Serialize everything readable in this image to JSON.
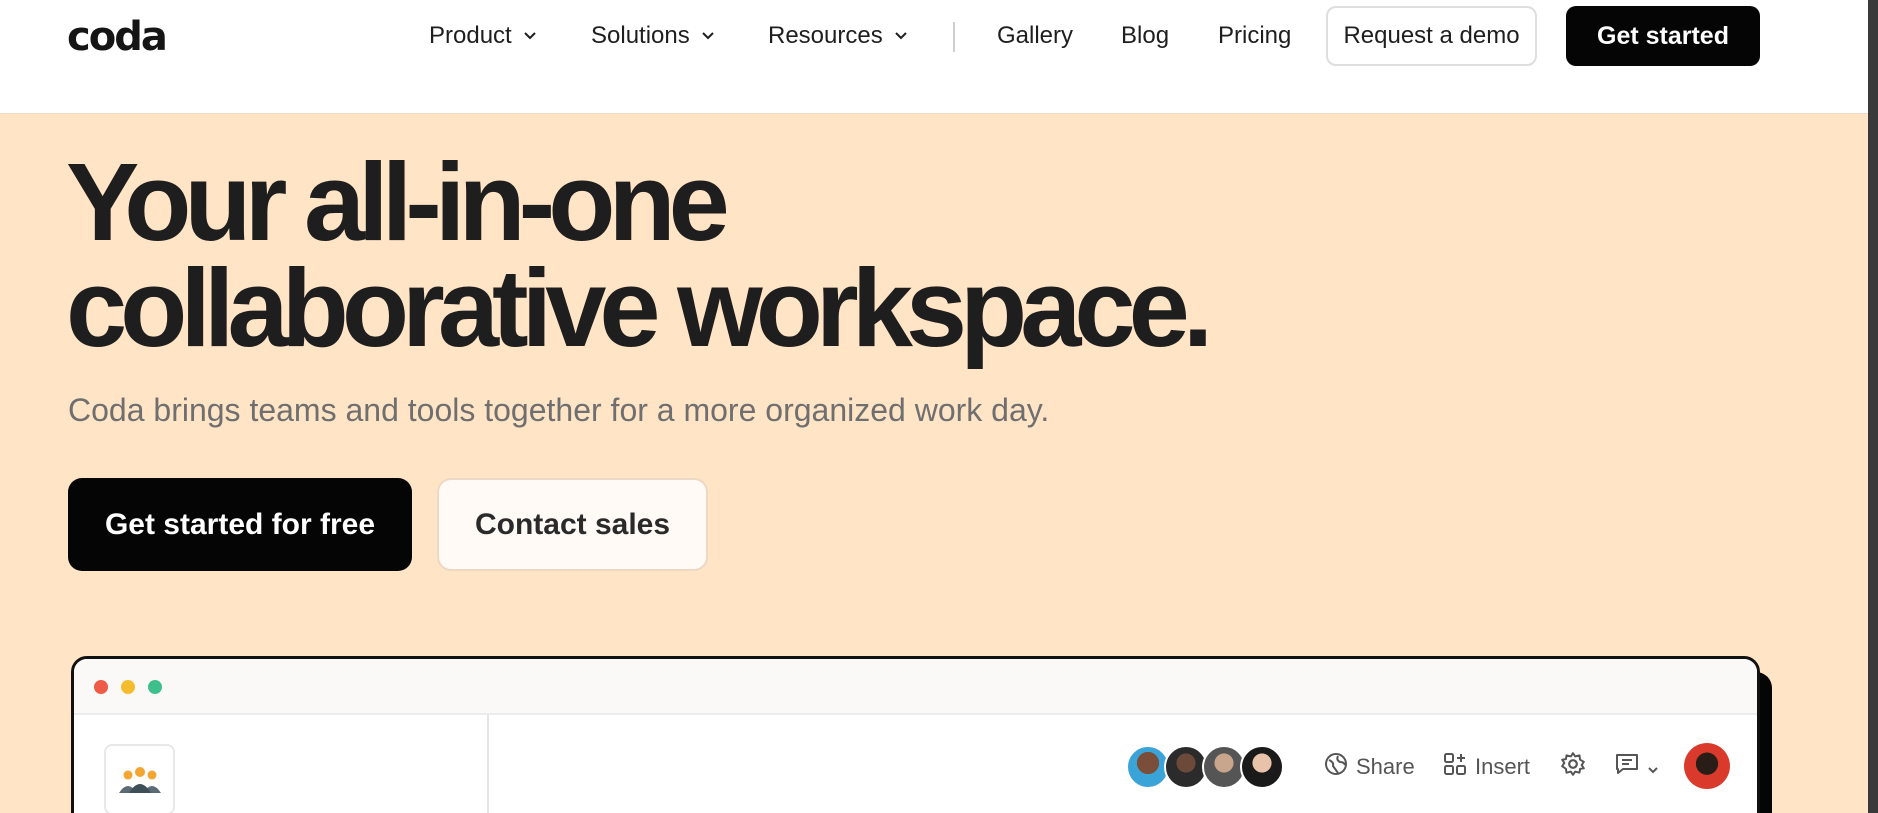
{
  "header": {
    "logo": "coda",
    "nav": [
      {
        "label": "Product",
        "dropdown": true
      },
      {
        "label": "Solutions",
        "dropdown": true
      },
      {
        "label": "Resources",
        "dropdown": true
      },
      {
        "label": "Gallery",
        "dropdown": false
      },
      {
        "label": "Blog",
        "dropdown": false
      },
      {
        "label": "Pricing",
        "dropdown": false
      }
    ],
    "request_demo_label": "Request a demo",
    "get_started_label": "Get started"
  },
  "hero": {
    "title_line1": "Your all-in-one",
    "title_line2": "collaborative workspace.",
    "subtitle": "Coda brings teams and tools together for a more organized work day.",
    "cta_primary": "Get started for free",
    "cta_secondary": "Contact sales"
  },
  "preview": {
    "window_controls": [
      "close",
      "minimize",
      "maximize"
    ],
    "toolbar": {
      "share_label": "Share",
      "insert_label": "Insert"
    }
  },
  "colors": {
    "hero_bg": "#ffe4c6",
    "primary_button": "#050505",
    "dot_red": "#ee5b47",
    "dot_yellow": "#f5bd2e",
    "dot_green": "#3fbf8b"
  }
}
